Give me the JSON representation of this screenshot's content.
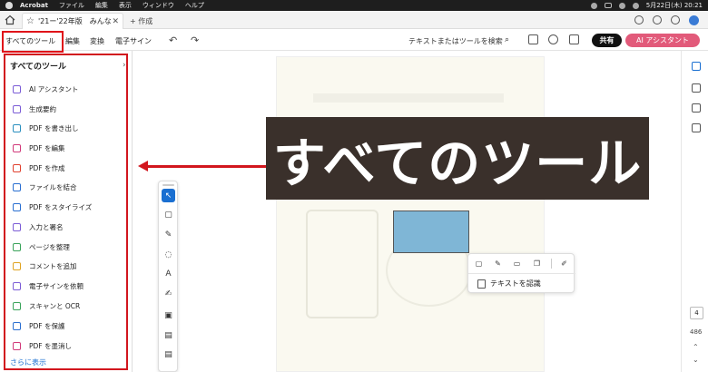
{
  "menubar": {
    "items": [
      "Acrobat",
      "ファイル",
      "編集",
      "表示",
      "ウィンドウ",
      "ヘルプ"
    ],
    "datetime": "5月22日(木) 20:21"
  },
  "tab": {
    "title": "'21ー'22年版　みんな...",
    "new_tab_label": "+ 作成"
  },
  "toolbar": {
    "menus": [
      "すべてのツール",
      "編集",
      "変換",
      "電子サイン"
    ],
    "search_placeholder": "テキストまたはツールを検索",
    "share_label": "共有",
    "ai_label": "AI アシスタント"
  },
  "panel": {
    "title": "すべてのツール",
    "tools": [
      {
        "label": "AI アシスタント",
        "color": "#7b5cd6"
      },
      {
        "label": "生成要約",
        "color": "#7b5cd6"
      },
      {
        "label": "PDF を書き出し",
        "color": "#2a8fbf"
      },
      {
        "label": "PDF を編集",
        "color": "#d13a7a"
      },
      {
        "label": "PDF を作成",
        "color": "#e0412f"
      },
      {
        "label": "ファイルを結合",
        "color": "#2a6fd1"
      },
      {
        "label": "PDF をスタイライズ",
        "color": "#2a6fd1"
      },
      {
        "label": "入力と署名",
        "color": "#7b5cd6"
      },
      {
        "label": "ページを整理",
        "color": "#3aa35a"
      },
      {
        "label": "コメントを追加",
        "color": "#e0a321"
      },
      {
        "label": "電子サインを依頼",
        "color": "#7b5cd6"
      },
      {
        "label": "スキャンと OCR",
        "color": "#3aa35a"
      },
      {
        "label": "PDF を保護",
        "color": "#2a6fd1"
      },
      {
        "label": "PDF を墨消し",
        "color": "#d13a7a"
      }
    ],
    "more_label": "さらに表示"
  },
  "banner": {
    "text": "すべてのツール"
  },
  "popup": {
    "recognize_label": "テキストを認識"
  },
  "right_rail": {
    "current_page": "4",
    "total_pages": "486"
  },
  "colors": {
    "accent_red": "#d2161e",
    "banner_bg": "#3a302b",
    "ai_button": "#e25a7a",
    "selection": "#7fb6d6"
  }
}
